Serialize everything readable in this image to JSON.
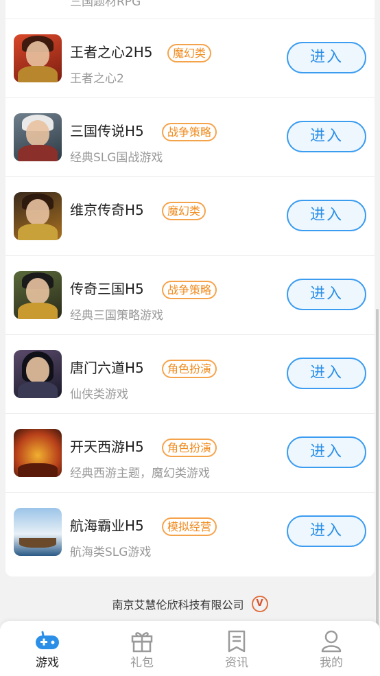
{
  "previous_item": {
    "desc": "三国题材RPG"
  },
  "games": [
    {
      "title": "王者之心2H5",
      "tag": "魔幻类",
      "desc": "王者之心2",
      "button": "进入"
    },
    {
      "title": "三国传说H5",
      "tag": "战争策略",
      "desc": "经典SLG国战游戏",
      "button": "进入"
    },
    {
      "title": "维京传奇H5",
      "tag": "魔幻类",
      "desc": "",
      "button": "进入"
    },
    {
      "title": "传奇三国H5",
      "tag": "战争策略",
      "desc": "经典三国策略游戏",
      "button": "进入"
    },
    {
      "title": "唐门六道H5",
      "tag": "角色扮演",
      "desc": "仙侠类游戏",
      "button": "进入"
    },
    {
      "title": "开天西游H5",
      "tag": "角色扮演",
      "desc": "经典西游主题，魔幻类游戏",
      "button": "进入"
    },
    {
      "title": "航海霸业H5",
      "tag": "模拟经营",
      "desc": "航海类SLG游戏",
      "button": "进入"
    }
  ],
  "footer": {
    "company": "南京艾慧伦欣科技有限公司",
    "badge": "V"
  },
  "tabbar": {
    "tabs": [
      {
        "label": "游戏",
        "icon": "gamepad-icon",
        "active": true
      },
      {
        "label": "礼包",
        "icon": "gift-icon",
        "active": false
      },
      {
        "label": "资讯",
        "icon": "news-icon",
        "active": false
      },
      {
        "label": "我的",
        "icon": "user-icon",
        "active": false
      }
    ]
  },
  "colors": {
    "accent": "#2b8fe8",
    "tag": "#f08a1c"
  }
}
